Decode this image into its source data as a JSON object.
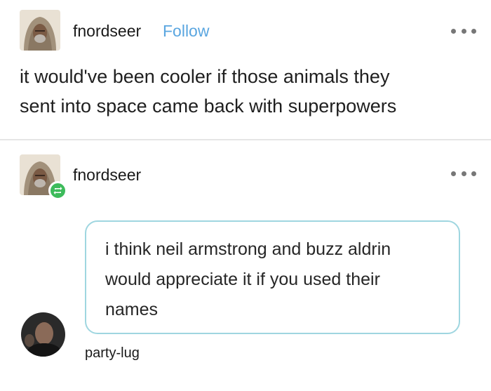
{
  "original_post": {
    "username": "fnordseer",
    "follow_label": "Follow",
    "text_lines": [
      "it would've been cooler if those animals they",
      "sent into space came back with superpowers"
    ]
  },
  "reblog": {
    "username": "fnordseer"
  },
  "reply": {
    "text_lines": [
      "i think neil armstrong and buzz aldrin",
      "would appreciate it if you used their",
      "names"
    ],
    "username": "party-lug"
  },
  "colors": {
    "follow": "#5aa6e0",
    "reblog_badge": "#3dbb5b",
    "bubble_border": "#9fd6e0"
  }
}
